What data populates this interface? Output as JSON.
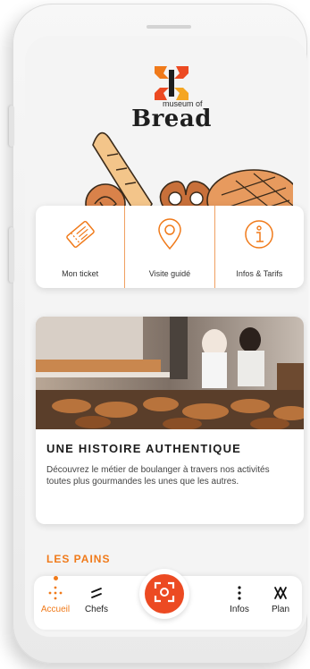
{
  "logo": {
    "small": "museum of",
    "main": "Bread"
  },
  "quick_actions": [
    {
      "label": "Mon ticket",
      "icon": "ticket-icon"
    },
    {
      "label": "Visite guidé",
      "icon": "map-pin-icon"
    },
    {
      "label": "Infos & Tarifs",
      "icon": "info-icon"
    }
  ],
  "feature": {
    "title": "UNE HISTOIRE AUTHENTIQUE",
    "text": "Découvrez le métier de boulanger à travers nos activités toutes plus gourmandes les unes que les autres."
  },
  "section_title": "LES PAINS",
  "nav": {
    "items": [
      {
        "label": "Accueil",
        "icon": "home-dots-icon",
        "active": true
      },
      {
        "label": "Chefs",
        "icon": "chefs-icon",
        "active": false
      },
      {
        "label": "Infos",
        "icon": "info-dots-icon",
        "active": false
      },
      {
        "label": "Plan",
        "icon": "plan-icon",
        "active": false
      }
    ],
    "scan_icon": "scan-icon"
  },
  "colors": {
    "accent": "#f07a1a",
    "scan": "#ec4a22"
  }
}
